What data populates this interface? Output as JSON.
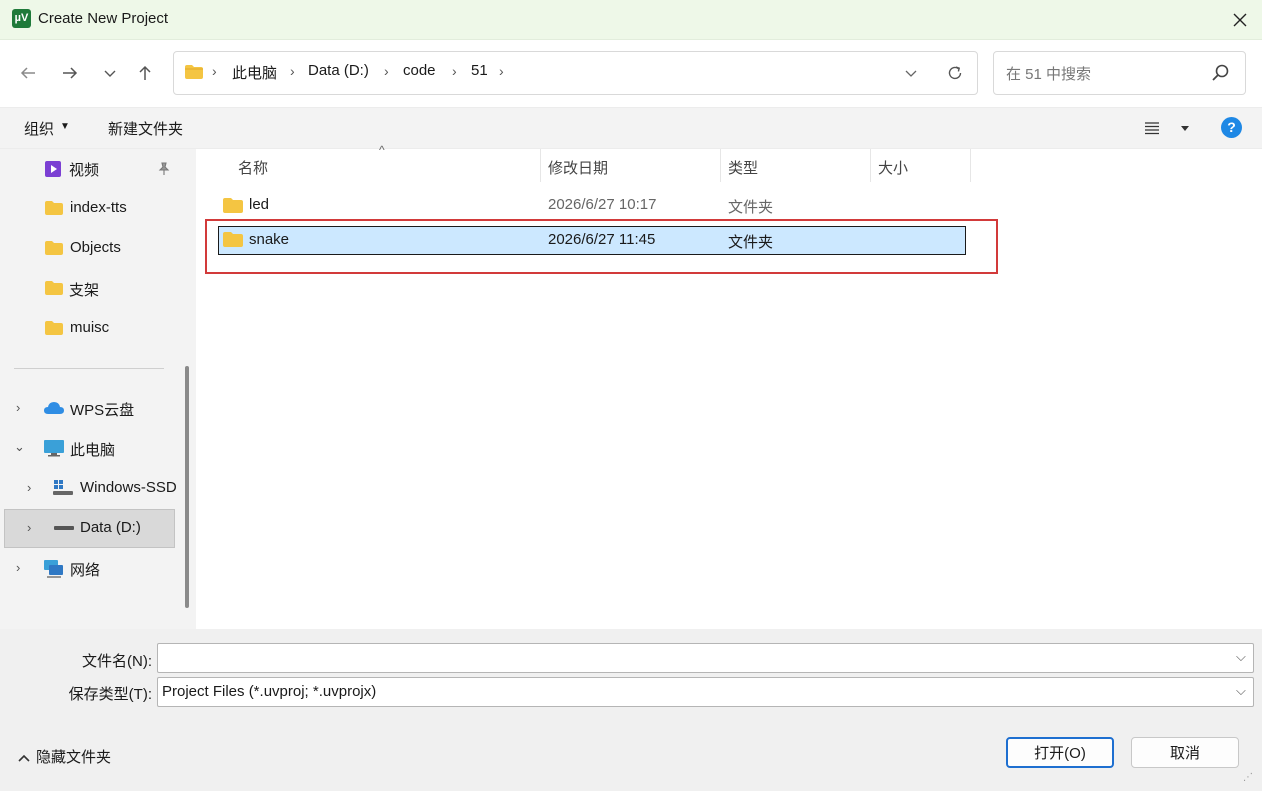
{
  "window": {
    "title": "Create New Project",
    "app_icon": "µV"
  },
  "nav": {
    "breadcrumbs": [
      "此电脑",
      "Data (D:)",
      "code",
      "51"
    ],
    "search_placeholder": "在 51 中搜索"
  },
  "toolbar": {
    "organize": "组织",
    "new_folder": "新建文件夹"
  },
  "sidebar": {
    "items": [
      {
        "label": "视频"
      },
      {
        "label": "index-tts"
      },
      {
        "label": "Objects"
      },
      {
        "label": "支架"
      },
      {
        "label": "muisc"
      },
      {
        "label": "WPS云盘"
      },
      {
        "label": "此电脑"
      },
      {
        "label": "Windows-SSD"
      },
      {
        "label": "Data (D:)"
      },
      {
        "label": "网络"
      }
    ]
  },
  "columns": {
    "name": "名称",
    "modified": "修改日期",
    "type": "类型",
    "size": "大小"
  },
  "files": [
    {
      "name": "led",
      "modified": "2026/6/27 10:17",
      "type": "文件夹",
      "selected": false
    },
    {
      "name": "snake",
      "modified": "2026/6/27 11:45",
      "type": "文件夹",
      "selected": true
    }
  ],
  "bottom": {
    "filename_label": "文件名(N):",
    "filename_value": "",
    "filetype_label": "保存类型(T):",
    "filetype_value": "Project Files (*.uvproj; *.uvprojx)",
    "hide_folders": "隐藏文件夹",
    "open_button": "打开(O)",
    "cancel_button": "取消"
  },
  "colors": {
    "accent": "#1e88e5",
    "selection": "#cce8ff",
    "highlight_box": "#d23a3a",
    "folder": "#f4c542"
  }
}
